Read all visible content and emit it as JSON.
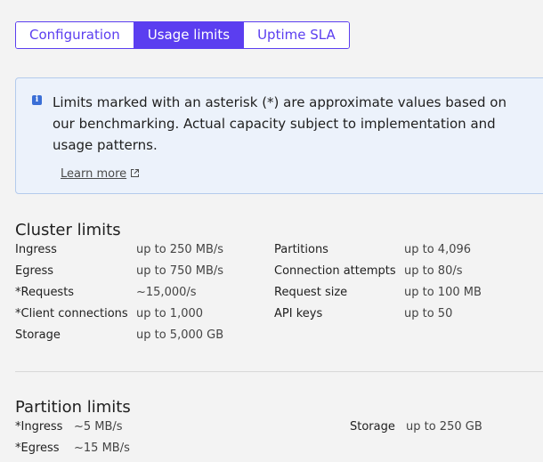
{
  "tabs": [
    {
      "label": "Configuration",
      "active": false
    },
    {
      "label": "Usage limits",
      "active": true
    },
    {
      "label": "Uptime SLA",
      "active": false
    }
  ],
  "info": {
    "icon": "info-icon",
    "text": "Limits marked with an asterisk (*) are approximate values based on our benchmarking. Actual capacity subject to implementation and usage patterns.",
    "learn_more": "Learn more"
  },
  "cluster": {
    "title": "Cluster limits",
    "left": [
      {
        "label": "Ingress",
        "value": "up to 250 MB/s"
      },
      {
        "label": "Egress",
        "value": "up to 750 MB/s"
      },
      {
        "label": "*Requests",
        "value": "~15,000/s"
      },
      {
        "label": "*Client connections",
        "value": "up to 1,000"
      },
      {
        "label": "Storage",
        "value": "up to 5,000 GB"
      }
    ],
    "right": [
      {
        "label": "Partitions",
        "value": "up to 4,096"
      },
      {
        "label": "Connection attempts",
        "value": "up to 80/s"
      },
      {
        "label": "Request size",
        "value": "up to 100 MB"
      },
      {
        "label": "API keys",
        "value": "up to 50"
      }
    ]
  },
  "partition": {
    "title": "Partition limits",
    "left": [
      {
        "label": "*Ingress",
        "value": "~5 MB/s"
      },
      {
        "label": "*Egress",
        "value": "~15 MB/s"
      }
    ],
    "right": [
      {
        "label": "Storage",
        "value": "up to 250 GB"
      }
    ]
  },
  "colors": {
    "accent": "#5b3ef0",
    "info_bg": "#ecf2fb",
    "info_border": "#b4cbec"
  }
}
